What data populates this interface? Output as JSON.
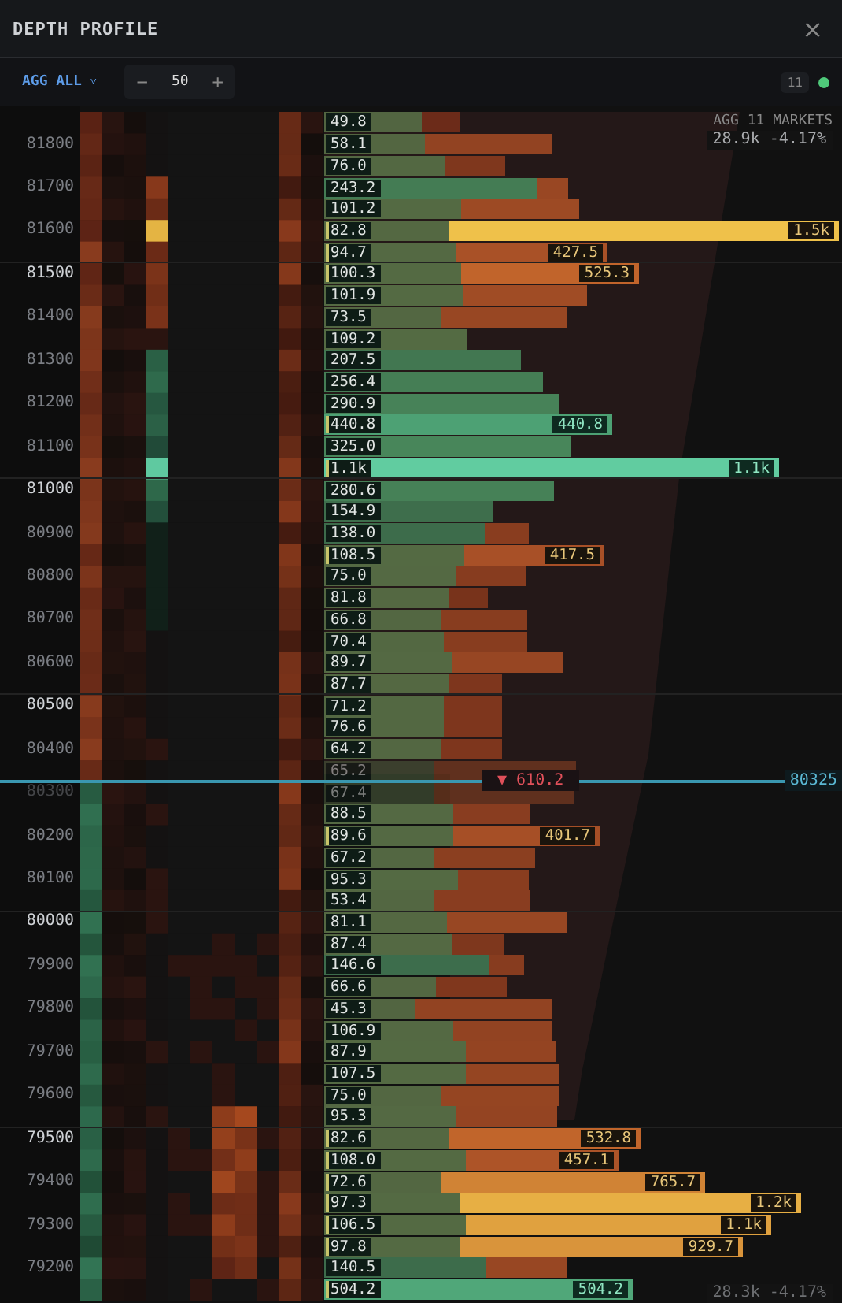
{
  "window": {
    "title": "DEPTH PROFILE",
    "close": "×"
  },
  "toolbar": {
    "aggregation": "AGG ALL",
    "caret": "˅",
    "stepper": {
      "minus": "−",
      "value": "50",
      "plus": "+"
    },
    "markets_count": "11",
    "connected": true
  },
  "overlay": {
    "markets": "AGG 11 MARKETS",
    "top_summary": "28.9k -4.17%",
    "bottom_summary": "28.3k -4.17%"
  },
  "mid": {
    "delta": "▼ 610.2",
    "price": "80325"
  },
  "rows": [
    {
      "volume": "49.8"
    },
    {
      "volume": "58.1",
      "price": "81800",
      "major": false
    },
    {
      "volume": "76.0"
    },
    {
      "volume": "243.2",
      "price": "81700",
      "major": false
    },
    {
      "volume": "101.2"
    },
    {
      "volume": "82.8",
      "price": "81600",
      "major": false,
      "callout": "1.5k"
    },
    {
      "volume": "94.7",
      "callout": "427.5"
    },
    {
      "volume": "100.3",
      "price": "81500",
      "major": true,
      "callout": "525.3"
    },
    {
      "volume": "101.9"
    },
    {
      "volume": "73.5",
      "price": "81400",
      "major": false
    },
    {
      "volume": "109.2"
    },
    {
      "volume": "207.5",
      "price": "81300",
      "major": false
    },
    {
      "volume": "256.4"
    },
    {
      "volume": "290.9",
      "price": "81200",
      "major": false
    },
    {
      "volume": "440.8",
      "callout": "440.8"
    },
    {
      "volume": "325.0",
      "price": "81100",
      "major": false
    },
    {
      "volume": "1.1k",
      "callout": "1.1k"
    },
    {
      "volume": "280.6",
      "price": "81000",
      "major": true
    },
    {
      "volume": "154.9"
    },
    {
      "volume": "138.0",
      "price": "80900",
      "major": false
    },
    {
      "volume": "108.5",
      "callout": "417.5"
    },
    {
      "volume": "75.0",
      "price": "80800",
      "major": false
    },
    {
      "volume": "81.8"
    },
    {
      "volume": "66.8",
      "price": "80700",
      "major": false
    },
    {
      "volume": "70.4"
    },
    {
      "volume": "89.7",
      "price": "80600",
      "major": false
    },
    {
      "volume": "87.7"
    },
    {
      "volume": "71.2",
      "price": "80500",
      "major": true
    },
    {
      "volume": "76.6"
    },
    {
      "volume": "64.2",
      "price": "80400",
      "major": false
    },
    {
      "volume": "65.2",
      "dimmed": true
    },
    {
      "volume": "67.4",
      "price": "80300",
      "major": false,
      "dimmed": true
    },
    {
      "volume": "88.5"
    },
    {
      "volume": "89.6",
      "price": "80200",
      "major": false,
      "callout": "401.7"
    },
    {
      "volume": "67.2"
    },
    {
      "volume": "95.3",
      "price": "80100",
      "major": false
    },
    {
      "volume": "53.4"
    },
    {
      "volume": "81.1",
      "price": "80000",
      "major": true
    },
    {
      "volume": "87.4"
    },
    {
      "volume": "146.6",
      "price": "79900",
      "major": false
    },
    {
      "volume": "66.6"
    },
    {
      "volume": "45.3",
      "price": "79800",
      "major": false
    },
    {
      "volume": "106.9"
    },
    {
      "volume": "87.9",
      "price": "79700",
      "major": false
    },
    {
      "volume": "107.5"
    },
    {
      "volume": "75.0",
      "price": "79600",
      "major": false
    },
    {
      "volume": "95.3"
    },
    {
      "volume": "82.6",
      "price": "79500",
      "major": true,
      "callout": "532.8"
    },
    {
      "volume": "108.0",
      "callout": "457.1"
    },
    {
      "volume": "72.6",
      "price": "79400",
      "major": false,
      "callout": "765.7"
    },
    {
      "volume": "97.3",
      "callout": "1.2k"
    },
    {
      "volume": "106.5",
      "price": "79300",
      "major": false,
      "callout": "1.1k"
    },
    {
      "volume": "97.8",
      "callout": "929.7"
    },
    {
      "volume": "140.5",
      "price": "79200",
      "major": false
    },
    {
      "volume": "504.2",
      "callout": "504.2"
    }
  ]
}
